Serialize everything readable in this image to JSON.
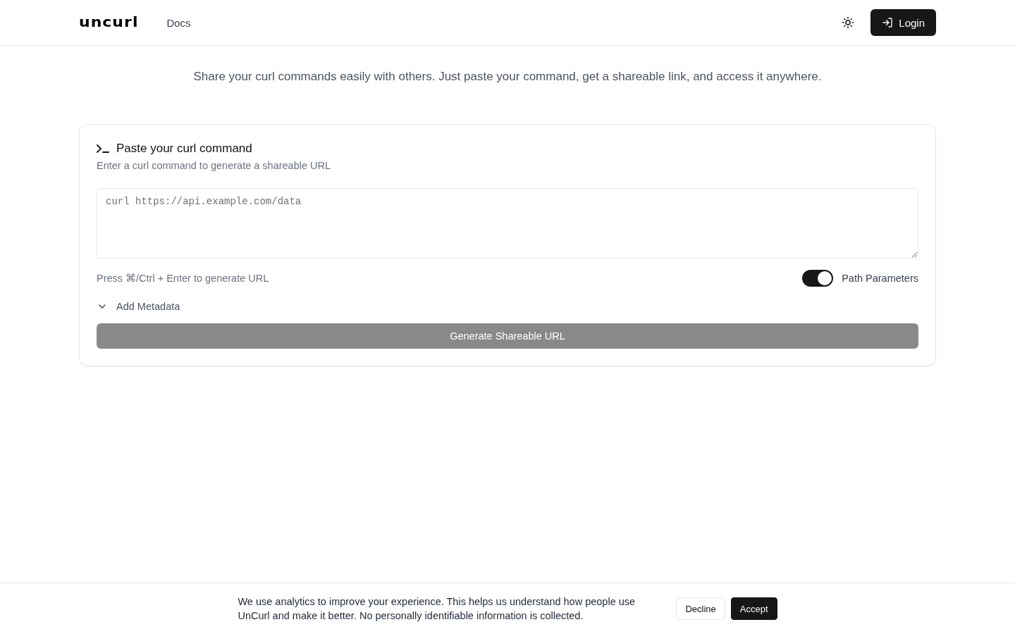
{
  "header": {
    "logo": "uncurl",
    "nav": [
      {
        "label": "Docs"
      }
    ],
    "login": "Login"
  },
  "tagline": "Share your curl commands easily with others. Just paste your command, get a shareable link, and access it anywhere.",
  "card": {
    "title": "Paste your curl command",
    "subtitle": "Enter a curl command to generate a shareable URL",
    "placeholder": "curl https://api.example.com/data",
    "hint": "Press ⌘/Ctrl + Enter to generate URL",
    "toggle": {
      "label": "Path Parameters",
      "on": true
    },
    "metadata": {
      "label": "Add Metadata",
      "expanded": false
    },
    "generate": {
      "label": "Generate Shareable URL",
      "disabled": true
    }
  },
  "cookie_banner": {
    "text": "We use analytics to improve your experience. This helps us understand how people use UnCurl and make it better. No personally identifiable information is collected.",
    "buttons": [
      {
        "label": "Decline",
        "kind": "secondary"
      },
      {
        "label": "Accept",
        "kind": "primary"
      }
    ]
  }
}
